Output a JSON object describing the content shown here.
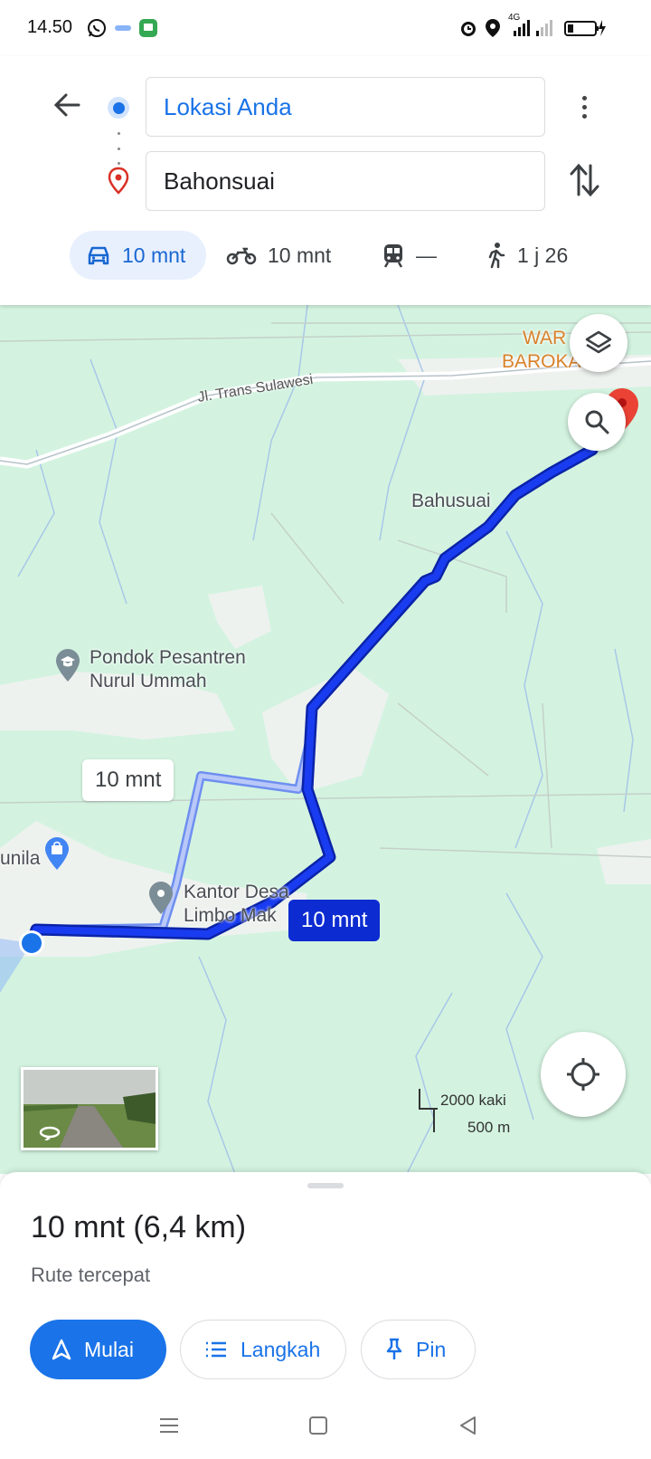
{
  "status_bar": {
    "time": "14.50",
    "network": "4G"
  },
  "directions": {
    "origin": "Lokasi Anda",
    "destination": "Bahonsuai"
  },
  "modes": [
    {
      "name": "car",
      "label": "10 mnt",
      "active": true
    },
    {
      "name": "motorcycle",
      "label": "10 mnt",
      "active": false
    },
    {
      "name": "transit",
      "label": "—",
      "active": false
    },
    {
      "name": "walk",
      "label": "1 j 26",
      "active": false
    }
  ],
  "map": {
    "labels": {
      "road": "Jl. Trans Sulawesi",
      "village": "Bahusuai",
      "poi_school_1": "Pondok Pesantren",
      "poi_school_2": "Nurul Ummah",
      "poi_office_1": "Kantor Desa",
      "poi_office_2": "Limbo Mak",
      "poi_shop": "unila",
      "poi_restaurant_1": "WAR   MAK",
      "poi_restaurant_2": "BAROKA    MB"
    },
    "alt_route_time": "10 mnt",
    "main_route_time": "10 mnt",
    "scale_imperial": "2000 kaki",
    "scale_metric": "500 m",
    "colors": {
      "route": "#0c2bd1",
      "alt_route": "#9fb3f5",
      "map_bg": "#d3f3e0"
    }
  },
  "sheet": {
    "title": "10 mnt (6,4 km)",
    "subtitle": "Rute tercepat",
    "start_label": "Mulai",
    "steps_label": "Langkah",
    "pin_label": "Pin"
  }
}
